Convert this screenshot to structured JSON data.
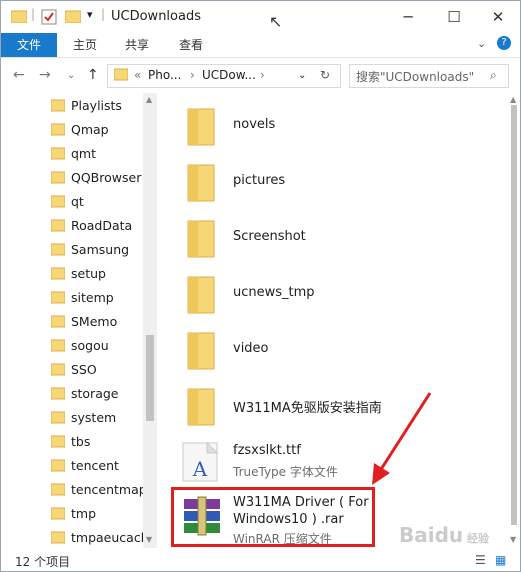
{
  "window": {
    "title": "UCDownloads"
  },
  "ribbon": {
    "tabs": [
      "文件",
      "主页",
      "共享",
      "查看"
    ]
  },
  "address": {
    "segments": [
      "«",
      "Pho...",
      "UCDow..."
    ]
  },
  "search": {
    "placeholder": "搜索\"UCDownloads\""
  },
  "nav": {
    "items": [
      "Playlists",
      "Qmap",
      "qmt",
      "QQBrowser",
      "qt",
      "RoadData",
      "Samsung",
      "setup",
      "sitemp",
      "SMemo",
      "sogou",
      "SSO",
      "storage",
      "system",
      "tbs",
      "tencent",
      "tencentmaps",
      "tmp",
      "tmpaeucach"
    ]
  },
  "files": [
    {
      "name": "novels"
    },
    {
      "name": "pictures"
    },
    {
      "name": "Screenshot"
    },
    {
      "name": "ucnews_tmp"
    },
    {
      "name": "video"
    },
    {
      "name": "W311MA免驱版安装指南"
    }
  ],
  "ttf_file": {
    "name": "fzsxslkt.ttf",
    "type": "TrueType 字体文件"
  },
  "rar_file": {
    "name_line1": "W311MA Driver ( For",
    "name_line2": "Windows10 ) .rar",
    "type": "WinRAR 压缩文件"
  },
  "status": {
    "count": "12 个项目"
  },
  "colors": {
    "accent": "#1979ca",
    "folder": "#f6d675",
    "highlight": "#e02020"
  },
  "icons": [
    "folder-icon",
    "check-icon",
    "dropdown-icon",
    "minimize-icon",
    "maximize-icon",
    "close-icon",
    "help-icon",
    "back-icon",
    "forward-icon",
    "up-icon",
    "refresh-icon",
    "search-icon",
    "ttf-font-icon",
    "winrar-icon",
    "details-view-icon",
    "large-icons-view-icon"
  ]
}
